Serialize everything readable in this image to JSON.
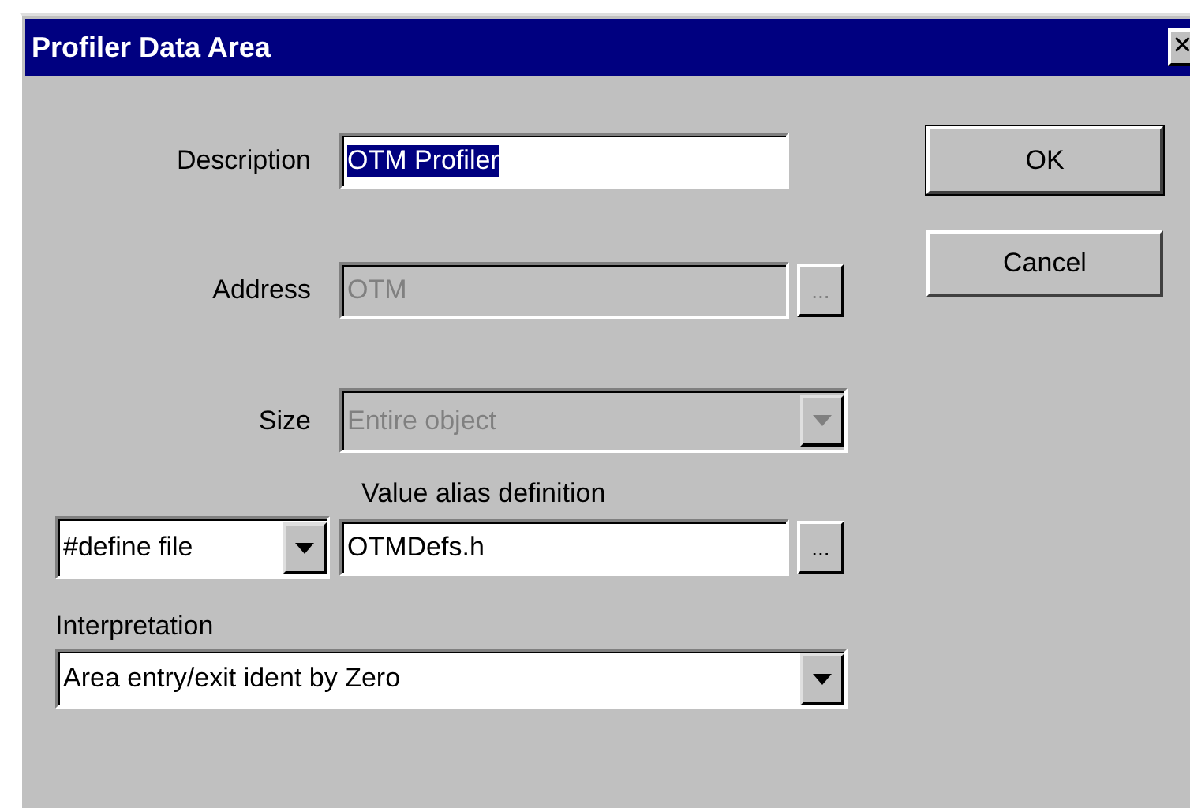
{
  "window": {
    "title": "Profiler Data Area",
    "close": "✕"
  },
  "description": {
    "label": "Description",
    "value": "OTM Profiler",
    "selected": true,
    "disabled": false
  },
  "address": {
    "label": "Address",
    "value": "OTM",
    "disabled": true,
    "browse": "..."
  },
  "size": {
    "label": "Size",
    "value": "Entire object",
    "disabled": true
  },
  "value_alias": {
    "label": "Value alias definition",
    "type": "#define file",
    "value": "OTMDefs.h",
    "browse": "..."
  },
  "interpretation": {
    "label": "Interpretation",
    "value": "Area entry/exit ident by Zero"
  },
  "buttons": [
    {
      "label": "OK",
      "default": true
    },
    {
      "label": "Cancel",
      "default": false
    }
  ]
}
